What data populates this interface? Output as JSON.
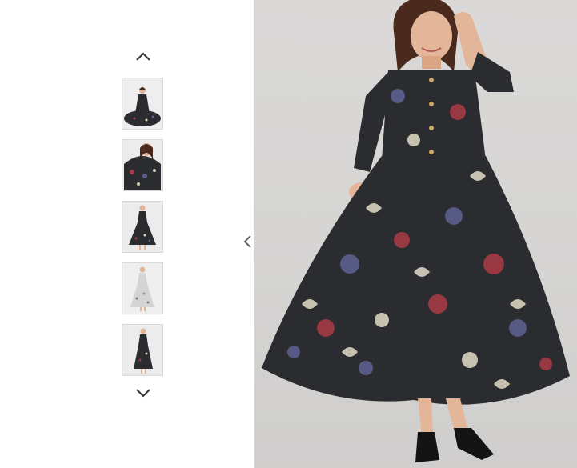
{
  "gallery": {
    "up_icon": "chevron-up-icon",
    "down_icon": "chevron-down-icon",
    "thumbnails": [
      {
        "view": "seated",
        "tone": "#2a2b2e"
      },
      {
        "view": "close-up",
        "tone": "#2a2b2e"
      },
      {
        "view": "front",
        "tone": "#2a2b2e"
      },
      {
        "view": "white-variant",
        "tone": "#d9d9d9"
      },
      {
        "view": "side",
        "tone": "#2a2b2e"
      }
    ]
  },
  "viewer": {
    "prev_icon": "chevron-left-icon",
    "image": "product-photo-black-floral-maxi-dress"
  },
  "colors": {
    "dress": "#2b2c2f",
    "pattern_light": "#d8d2bf",
    "pattern_red": "#a33a45",
    "pattern_blue": "#5b5f8e",
    "skin": "#e4b699",
    "hair": "#4a2a1c",
    "background": "#d7d6d5"
  }
}
